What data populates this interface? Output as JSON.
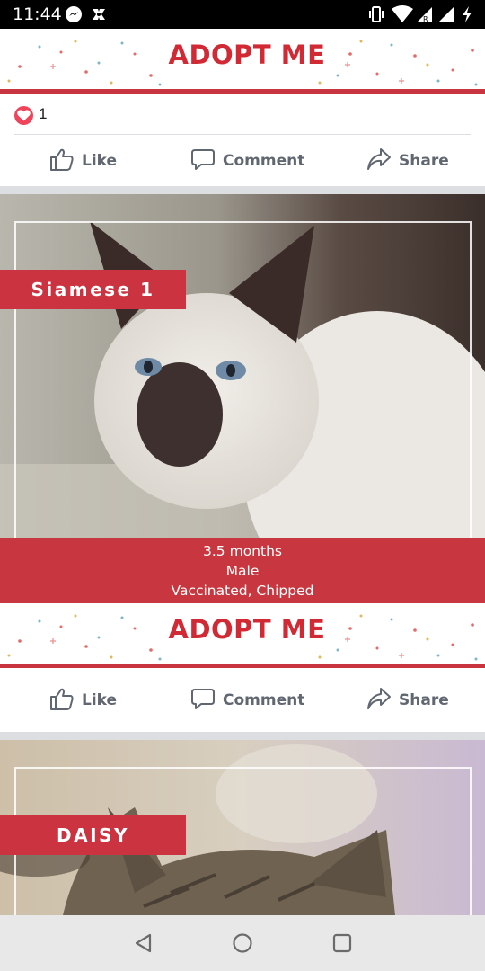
{
  "status_bar": {
    "time": "11:44",
    "left_icons": [
      "messenger-icon",
      "app-notification-icon"
    ],
    "right_icons": [
      "vibrate-icon",
      "wifi-icon",
      "signal-r-icon",
      "signal-icon",
      "charging-icon"
    ]
  },
  "colors": {
    "accent_red": "#c8373f",
    "banner_red": "#d12a35",
    "heart": "#f0445b"
  },
  "post1": {
    "banner_title": "ADOPT ME",
    "reaction_count": "1",
    "actions": {
      "like": "Like",
      "comment": "Comment",
      "share": "Share"
    }
  },
  "post2": {
    "name": "Siamese 1",
    "info_lines": [
      "3.5 months",
      "Male",
      "Vaccinated, Chipped"
    ],
    "banner_title": "ADOPT ME",
    "actions": {
      "like": "Like",
      "comment": "Comment",
      "share": "Share"
    }
  },
  "post3": {
    "name": "DAISY"
  },
  "nav_bar": {
    "buttons": [
      "back-icon",
      "home-icon",
      "recents-icon"
    ]
  }
}
